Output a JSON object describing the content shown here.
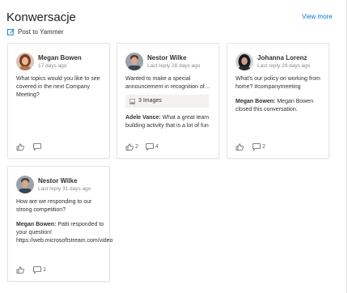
{
  "header": {
    "title": "Konwersacje",
    "view_more": "View more",
    "post_label": "Post to Yammer"
  },
  "colors": {
    "link": "#0078d4",
    "card_border": "#e7e6e5",
    "muted_text": "#8a8886"
  },
  "cards": [
    {
      "author": "Megan Bowen",
      "time": "17 days ago",
      "text": "What topics would you like to see covered in the next Company Meeting?",
      "likes": "",
      "comments": ""
    },
    {
      "author": "Nestor Wilke",
      "time": "Last reply 28 days ago",
      "text": "Wanted to make a special announcement in recognition of our team",
      "attachment": "3 Images",
      "reply_author": "Adele Vance:",
      "reply_text": "What a great team building activity that is a lot of fun",
      "likes": "2",
      "comments": "4"
    },
    {
      "author": "Johanna Lorenz",
      "time": "Last reply 29 days ago",
      "text": "What's our policy on working from home? #companymeeting",
      "reply_author": "Megan Bowen:",
      "reply_text": "Megan Bowen closed this conversation.",
      "likes": "",
      "comments": "2"
    },
    {
      "author": "Nestor Wilke",
      "time": "Last reply 31 days ago",
      "text": "How are we responding to our strong competition?",
      "reply_author": "Megan Bowen:",
      "reply_text": "Patti responded to your question! https://web.microsoftstream.com/video",
      "likes": "",
      "comments": "1"
    }
  ]
}
